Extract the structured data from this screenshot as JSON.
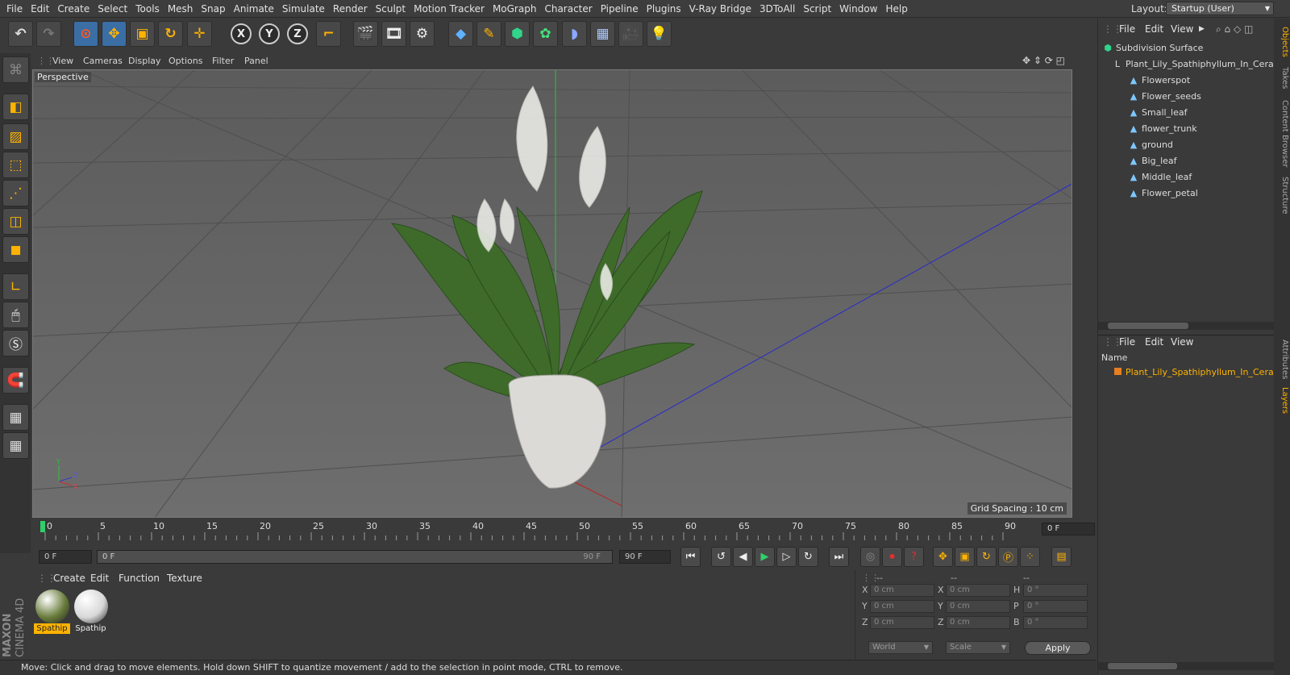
{
  "menubar": {
    "items": [
      "File",
      "Edit",
      "Create",
      "Select",
      "Tools",
      "Mesh",
      "Snap",
      "Animate",
      "Simulate",
      "Render",
      "Sculpt",
      "Motion Tracker",
      "MoGraph",
      "Character",
      "Pipeline",
      "Plugins",
      "V-Ray Bridge",
      "3DToAll",
      "Script",
      "Window",
      "Help"
    ],
    "layout_label": "Layout:",
    "layout_value": "Startup (User)"
  },
  "toolbar": {
    "icons": [
      "undo-icon",
      "redo-icon",
      "live-selection-icon",
      "move-icon",
      "scale-icon",
      "rotate-icon",
      "last-tool-icon",
      "x-axis-icon",
      "y-axis-icon",
      "z-axis-icon",
      "coordinate-system-icon",
      "render-view-icon",
      "render-picture-viewer-icon",
      "edit-render-settings-icon",
      "cube-icon",
      "pen-icon",
      "subdivision-icon",
      "cloner-icon",
      "deformer-icon",
      "floor-icon",
      "camera-icon",
      "light-icon"
    ],
    "axis_labels": [
      "X",
      "Y",
      "Z"
    ]
  },
  "viewport": {
    "menu": [
      "View",
      "Cameras",
      "Display",
      "Options",
      "Filter",
      "Panel"
    ],
    "label": "Perspective",
    "grid_spacing": "Grid Spacing : 10 cm"
  },
  "timeline": {
    "ticks": [
      "0",
      "5",
      "10",
      "15",
      "20",
      "25",
      "30",
      "35",
      "40",
      "45",
      "50",
      "55",
      "60",
      "65",
      "70",
      "75",
      "80",
      "85",
      "90"
    ],
    "current_frame": "0 F"
  },
  "transport": {
    "start_field": "0 F",
    "range_start": "0 F",
    "range_end": "90 F",
    "end_field": "90 F"
  },
  "materials": {
    "menu": [
      "Create",
      "Edit",
      "Function",
      "Texture"
    ],
    "items": [
      {
        "label": "Spathip",
        "selected": true,
        "color": "#6a7d3c"
      },
      {
        "label": "Spathip",
        "selected": false,
        "color": "#d8d8d8"
      }
    ]
  },
  "coordinates": {
    "headers": [
      "--",
      "--",
      "--"
    ],
    "rows": [
      {
        "a": "X",
        "av": "0 cm",
        "b": "X",
        "bv": "0 cm",
        "c": "H",
        "cv": "0 °"
      },
      {
        "a": "Y",
        "av": "0 cm",
        "b": "Y",
        "bv": "0 cm",
        "c": "P",
        "cv": "0 °"
      },
      {
        "a": "Z",
        "av": "0 cm",
        "b": "Z",
        "bv": "0 cm",
        "c": "B",
        "cv": "0 °"
      }
    ],
    "mode1": "World",
    "mode2": "Scale",
    "apply": "Apply"
  },
  "status": "Move: Click and drag to move elements. Hold down SHIFT to quantize movement / add to the selection in point mode, CTRL to remove.",
  "logo": {
    "line1": "MAXON",
    "line2": "CINEMA 4D"
  },
  "objects_panel": {
    "menu": [
      "File",
      "Edit",
      "View"
    ],
    "root": "Subdivision Surface",
    "parent": "Plant_Lily_Spathiphyllum_In_Cera",
    "children": [
      "Flowerspot",
      "Flower_seeds",
      "Small_leaf",
      "flower_trunk",
      "ground",
      "Big_leaf",
      "Middle_leaf",
      "Flower_petal"
    ]
  },
  "layers_panel": {
    "menu": [
      "File",
      "Edit",
      "View"
    ],
    "column": "Name",
    "row": "Plant_Lily_Spathiphyllum_In_Cerar"
  },
  "side_tabs": [
    "Objects",
    "Takes",
    "Content Browser",
    "Structure",
    "Attributes",
    "Layers"
  ],
  "colors": {
    "accent": "#ffb300",
    "selection": "#3a6ea5",
    "layer_orange": "#e67e22"
  }
}
